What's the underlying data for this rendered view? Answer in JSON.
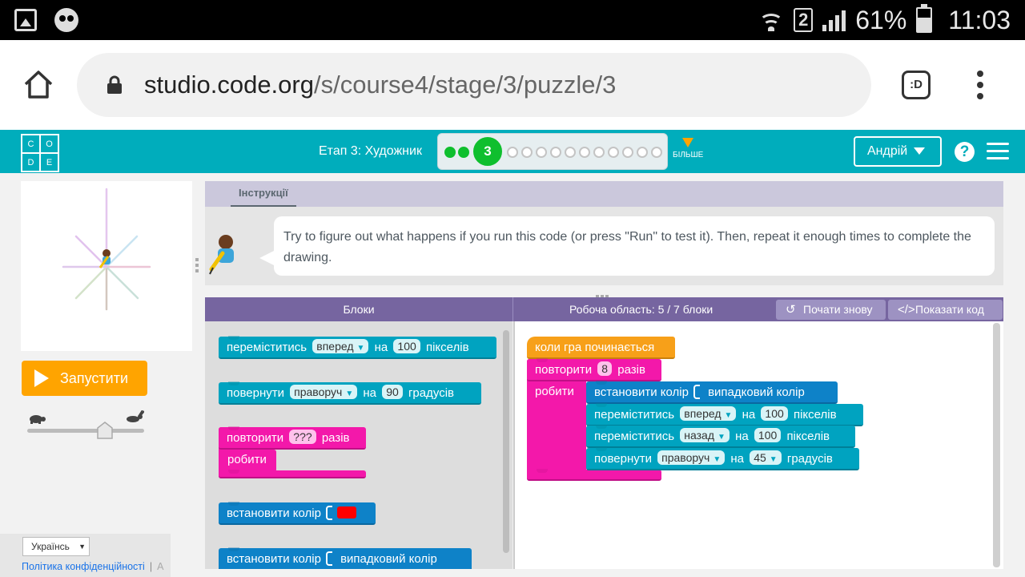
{
  "status_bar": {
    "sim_slot": "2",
    "battery": "61%",
    "time": "11:03"
  },
  "browser": {
    "url_host": "studio.code.org",
    "url_path": "/s/course4/stage/3/puzzle/3",
    "ext_label": ":D"
  },
  "header": {
    "logo": [
      "C",
      "O",
      "D",
      "E"
    ],
    "stage_title": "Етап 3: Художник",
    "current_puzzle": "3",
    "more_label": "БІЛЬШЕ",
    "user_name": "Андрій",
    "help_label": "?"
  },
  "left": {
    "run_label": "Запустити",
    "language": "Українсь",
    "privacy_link": "Політика конфіденційності",
    "sep": "|",
    "cut_text": "А"
  },
  "instructions": {
    "tab_label": "Інструкції",
    "text": "Try to figure out what happens if you run this code (or press \"Run\" to test it). Then, repeat it enough times to complete the drawing."
  },
  "workspace_header": {
    "blocks_title": "Блоки",
    "workspace_title": "Робоча область: 5 / 7 блоки",
    "reset_label": "Почати знову",
    "show_code_label": "Показати код"
  },
  "toolbox": {
    "move": {
      "verb": "переміститись",
      "dir": "вперед",
      "on": "на",
      "value": "100",
      "unit": "пікселів"
    },
    "turn": {
      "verb": "повернути",
      "dir": "праворуч",
      "on": "на",
      "value": "90",
      "unit": "градусів"
    },
    "repeat": {
      "verb": "повторити",
      "value": "???",
      "unit": "разів",
      "do": "робити"
    },
    "set_color": {
      "label": "встановити колір",
      "swatch_color": "#ff0000"
    },
    "set_random_color": {
      "label": "встановити колір",
      "value": "випадковий колір"
    }
  },
  "program": {
    "when_run": "коли гра починається",
    "repeat": {
      "verb": "повторити",
      "value": "8",
      "unit": "разів",
      "do": "робити"
    },
    "set_color": {
      "label": "встановити колір",
      "value": "випадковий колір"
    },
    "move_forward": {
      "verb": "переміститись",
      "dir": "вперед",
      "on": "на",
      "value": "100",
      "unit": "пікселів"
    },
    "move_back": {
      "verb": "переміститись",
      "dir": "назад",
      "on": "на",
      "value": "100",
      "unit": "пікселів"
    },
    "turn": {
      "verb": "повернути",
      "dir": "праворуч",
      "on": "на",
      "value": "45",
      "unit": "градусів"
    }
  },
  "colors": {
    "teal": "#00adbc",
    "purple": "#7665a0",
    "pink": "#f318aa",
    "orange": "#ffa400",
    "green": "#0fbf2e"
  }
}
